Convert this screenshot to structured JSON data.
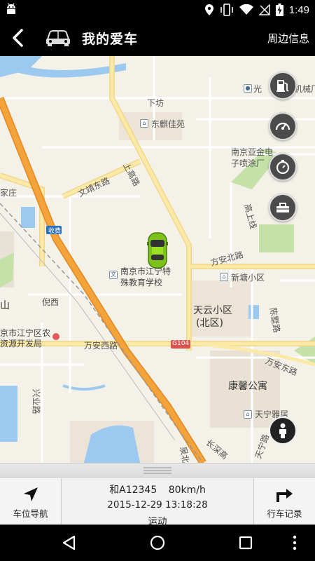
{
  "status_bar": {
    "time": "1:49",
    "icons": [
      "android-icon",
      "location-icon",
      "vibrate-icon",
      "wifi-icon",
      "no-signal-icon",
      "battery-charging-icon"
    ]
  },
  "header": {
    "title": "我的爱车",
    "nearby_label": "周边信息",
    "back_icon": "back-arrow-icon",
    "car_icon": "car-icon"
  },
  "map": {
    "labels": {
      "xiafang": "下坊",
      "dongqi": "东麒佳苑",
      "wenjing": "文靖东路",
      "shangao": "上高路",
      "nanjing_yajin_1": "南京亚金电",
      "nanjing_yajin_2": "子喷涂厂",
      "gaoshang": "高上线",
      "guangdian": "光",
      "jichang": "机械厂",
      "jiazhuang": "家庄",
      "jiaoyu_1": "南京市江宁特",
      "jiaoyu_2": "殊教育学校",
      "fanganbei": "方安北路",
      "xintang": "新塘小区",
      "tianyun_1": "天云小区",
      "tianyun_2": "(北区)",
      "nixi": "倪西",
      "shan": "山",
      "jiangning_1": "京市江宁区农",
      "jiangning_2": "资源开发局",
      "wananxi": "万安西路",
      "g104": "G104",
      "fangandong": "万安东路",
      "chenshu": "陈墅路",
      "kangxin": "康馨公寓",
      "tianning": "天宁雅居",
      "xingye": "兴业路",
      "changshen": "长深高",
      "jiaofei": "收费",
      "quanbei": "泉北",
      "tianning_rd": "天宁路"
    }
  },
  "side_buttons": [
    {
      "name": "gas-station-button",
      "icon": "gas-pump-icon"
    },
    {
      "name": "dashboard-button",
      "icon": "speedometer-icon"
    },
    {
      "name": "timer-button",
      "icon": "stopwatch-icon"
    },
    {
      "name": "repair-button",
      "icon": "toolbox-icon"
    }
  ],
  "person_button": {
    "icon": "person-icon"
  },
  "bottom_panel": {
    "nav_label": "车位导航",
    "plate": "和A12345",
    "speed": "80km/h",
    "datetime": "2015-12-29 13:18:28",
    "status": "运动",
    "record_label": "行车记录"
  },
  "nav_bar": {
    "icons": [
      "back-triangle-icon",
      "home-circle-icon",
      "recents-square-icon",
      "overflow-menu-icon"
    ]
  },
  "colors": {
    "highway": "#f4a23a",
    "major_road": "#fbe9a8",
    "water": "#9cc9ef",
    "park": "#c4e1a8",
    "map_bg": "#f4f1e9",
    "car": "#9be021"
  }
}
